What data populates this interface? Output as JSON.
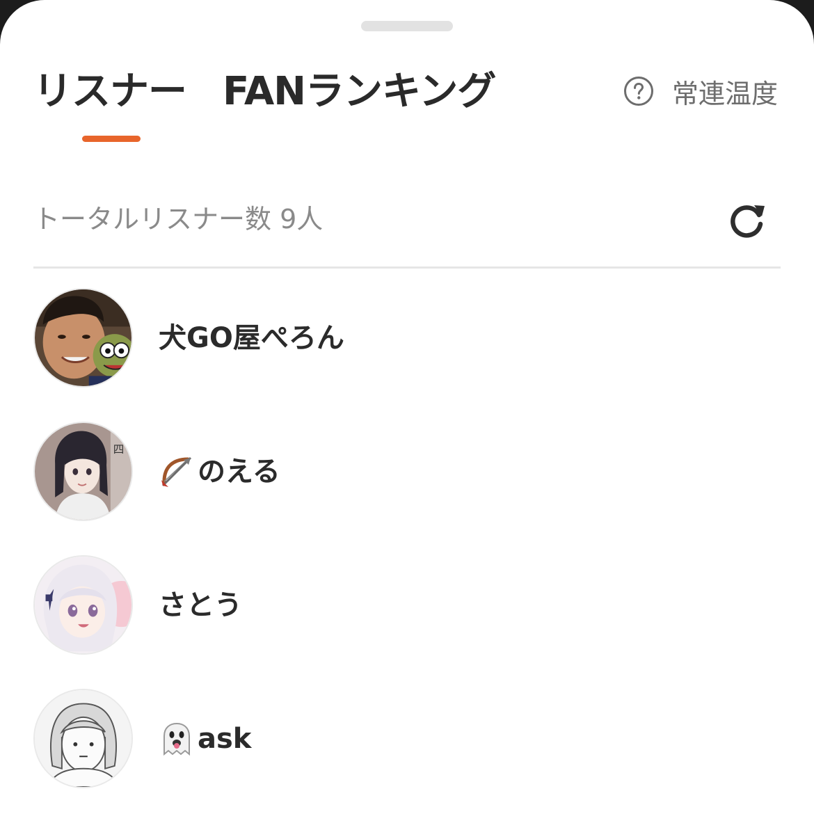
{
  "tabs": [
    {
      "label": "リスナー",
      "active": true
    },
    {
      "label": "FANランキング",
      "active": false
    }
  ],
  "help": {
    "icon": "question-circle-icon",
    "label": "常連温度"
  },
  "summary": {
    "total_label": "トータルリスナー数 9人",
    "refresh_icon": "refresh-icon"
  },
  "colors": {
    "accent": "#e8652b",
    "text": "#2b2b2b",
    "muted": "#8a8a8a"
  },
  "listeners": [
    {
      "name": "犬GO屋ぺろん",
      "emoji": "",
      "avatar": "photo-avatar"
    },
    {
      "name": "のえる",
      "emoji": "bow-and-arrow-emoji",
      "avatar": "anime-girl-dark-hair-avatar"
    },
    {
      "name": "さとう",
      "emoji": "",
      "avatar": "anime-girl-white-hair-avatar"
    },
    {
      "name": "ask",
      "emoji": "ghost-emoji",
      "avatar": "sketch-face-avatar"
    }
  ]
}
